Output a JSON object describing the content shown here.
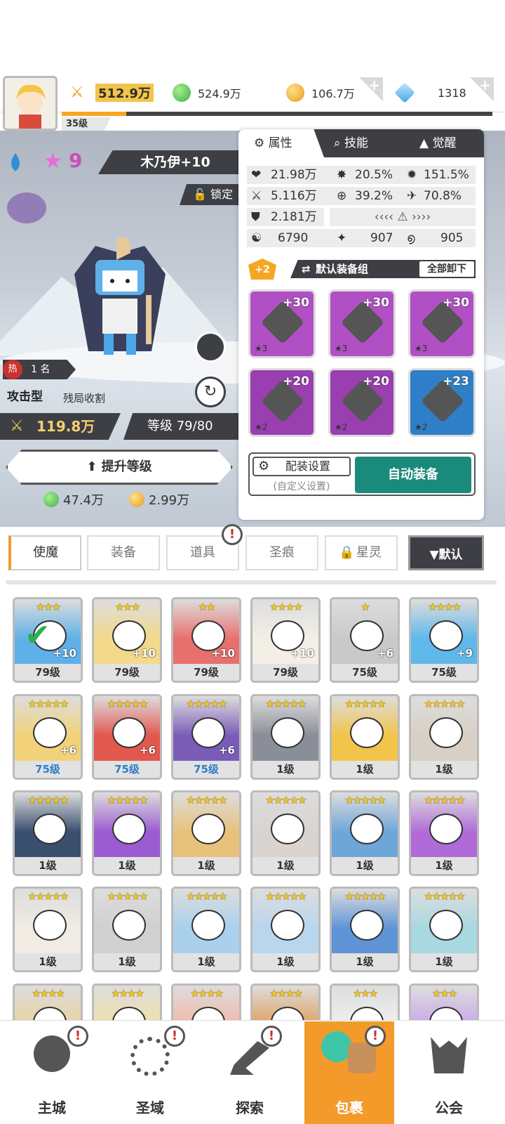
{
  "currencies": {
    "power": "512.9万",
    "green": "524.9万",
    "gold": "106.7万",
    "diamond": "1318"
  },
  "player_level": "35级",
  "player_level_progress": 0.15,
  "hero": {
    "element_icon": "water-drop-icon",
    "stars": "9",
    "name": "木乃伊+10",
    "lock_label": "锁定",
    "hot_label": "热",
    "rank": "1 名",
    "type": "攻击型",
    "role": "残局收割",
    "power": "119.8万",
    "level": "等级 79/80",
    "upgrade_label": "提升等级",
    "cost_green": "47.4万",
    "cost_gold": "2.99万"
  },
  "panel": {
    "tabs": [
      "属性",
      "技能",
      "觉醒"
    ],
    "stats": {
      "hp": "21.98万",
      "crit": "20.5%",
      "crit_dmg": "151.5%",
      "atk": "5.116万",
      "acc": "39.2%",
      "speed": "70.8%",
      "def": "2.181万",
      "s1": "6790",
      "s2": "907",
      "s3": "905"
    },
    "equip_badge": "+2",
    "equip_set": "默认装备组",
    "unequip_all": "全部卸下",
    "equipment": [
      {
        "bonus": "+30",
        "stars": "★3",
        "item": "sword",
        "color": "#b14fc4"
      },
      {
        "bonus": "+30",
        "stars": "★3",
        "item": "helmet",
        "color": "#b14fc4"
      },
      {
        "bonus": "+30",
        "stars": "★3",
        "item": "armor",
        "color": "#b14fc4"
      },
      {
        "bonus": "+20",
        "stars": "★2",
        "item": "belt",
        "color": "#9a3fb0"
      },
      {
        "bonus": "+20",
        "stars": "★2",
        "item": "necklace",
        "color": "#9a3fb0"
      },
      {
        "bonus": "+23",
        "stars": "★2",
        "item": "boots",
        "color": "#2f7fc8"
      }
    ],
    "config_label": "配装设置",
    "config_sub": "(自定义设置)",
    "auto_label": "自动装备"
  },
  "inventory_tabs": [
    "使魔",
    "装备",
    "道具",
    "圣痕",
    "星灵"
  ],
  "sort_label": "▼默认",
  "heroes": [
    {
      "lv": "79级",
      "stars": "★★★",
      "plus": "+10",
      "color": "#5fb0e8"
    },
    {
      "lv": "79级",
      "stars": "★★★",
      "plus": "+10",
      "color": "#f3d98a"
    },
    {
      "lv": "79级",
      "stars": "★★",
      "plus": "+10",
      "color": "#e8706c"
    },
    {
      "lv": "79级",
      "stars": "★★★★",
      "plus": "+10",
      "color": "#f3efe6"
    },
    {
      "lv": "75级",
      "stars": "★",
      "plus": "+6",
      "color": "#c9c9c9"
    },
    {
      "lv": "75级",
      "stars": "★★★★",
      "plus": "+9",
      "color": "#5fb8ea"
    },
    {
      "lv": "75级",
      "stars": "★★★★★",
      "plus": "+6",
      "color": "#f1d27a"
    },
    {
      "lv": "75级",
      "stars": "★★★★★",
      "plus": "+6",
      "color": "#e2574e"
    },
    {
      "lv": "75级",
      "stars": "★★★★★",
      "plus": "+6",
      "color": "#7a5cb8"
    },
    {
      "lv": "1级",
      "stars": "★★★★★",
      "plus": "",
      "color": "#8a8e98"
    },
    {
      "lv": "1级",
      "stars": "★★★★★",
      "plus": "",
      "color": "#f2c44a"
    },
    {
      "lv": "1级",
      "stars": "★★★★★",
      "plus": "",
      "color": "#d8d0c4"
    },
    {
      "lv": "1级",
      "stars": "★★★★★",
      "plus": "",
      "color": "#3a4f6e"
    },
    {
      "lv": "1级",
      "stars": "★★★★★",
      "plus": "",
      "color": "#9a5cd0"
    },
    {
      "lv": "1级",
      "stars": "★★★★★",
      "plus": "",
      "color": "#e8c27a"
    },
    {
      "lv": "1级",
      "stars": "★★★★★",
      "plus": "",
      "color": "#d9d4cf"
    },
    {
      "lv": "1级",
      "stars": "★★★★★",
      "plus": "",
      "color": "#6fa6d8"
    },
    {
      "lv": "1级",
      "stars": "★★★★★",
      "plus": "",
      "color": "#b06bd8"
    },
    {
      "lv": "1级",
      "stars": "★★★★★",
      "plus": "",
      "color": "#f0ebe3"
    },
    {
      "lv": "1级",
      "stars": "★★★★★",
      "plus": "",
      "color": "#d0d0d0"
    },
    {
      "lv": "1级",
      "stars": "★★★★★",
      "plus": "",
      "color": "#a9d0ec"
    },
    {
      "lv": "1级",
      "stars": "★★★★★",
      "plus": "",
      "color": "#b8d6ee"
    },
    {
      "lv": "1级",
      "stars": "★★★★★",
      "plus": "",
      "color": "#5f94d6"
    },
    {
      "lv": "1级",
      "stars": "★★★★★",
      "plus": "",
      "color": "#a8d8e0"
    },
    {
      "lv": "",
      "stars": "★★★★",
      "plus": "",
      "color": "#e8d3a0"
    },
    {
      "lv": "",
      "stars": "★★★★",
      "plus": "",
      "color": "#f0e0a8"
    },
    {
      "lv": "",
      "stars": "★★★★",
      "plus": "",
      "color": "#f2b8a8"
    },
    {
      "lv": "",
      "stars": "★★★★",
      "plus": "",
      "color": "#e0a060"
    },
    {
      "lv": "",
      "stars": "★★★",
      "plus": "",
      "color": "#f0f0f0"
    },
    {
      "lv": "",
      "stars": "★★★",
      "plus": "",
      "color": "#c8a8e8"
    }
  ],
  "nav": [
    "主城",
    "圣域",
    "探索",
    "包裹",
    "公会"
  ]
}
